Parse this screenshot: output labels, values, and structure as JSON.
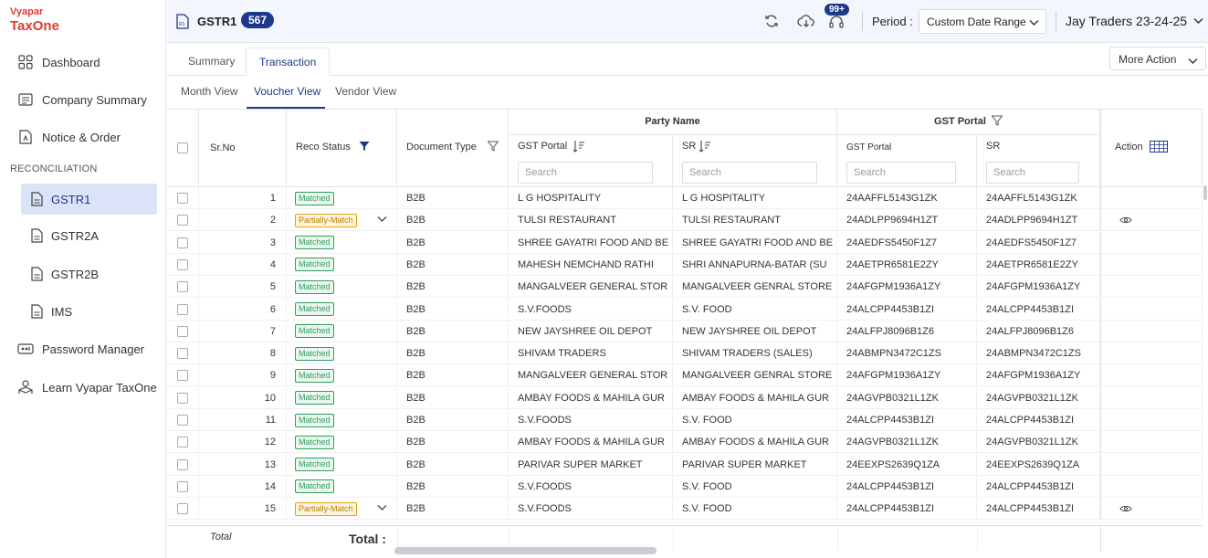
{
  "brand": {
    "line1": "Vyapar",
    "line2": "TaxOne"
  },
  "sidebar": {
    "items": [
      {
        "label": "Dashboard",
        "icon": "grid-icon"
      },
      {
        "label": "Company Summary",
        "icon": "list-icon"
      },
      {
        "label": "Notice & Order",
        "icon": "notice-icon"
      }
    ],
    "section": "RECONCILIATION",
    "sub_items": [
      {
        "label": "GSTR1",
        "icon": "document-icon",
        "active": true
      },
      {
        "label": "GSTR2A",
        "icon": "document-icon"
      },
      {
        "label": "GSTR2B",
        "icon": "document-icon"
      },
      {
        "label": "IMS",
        "icon": "document-icon"
      }
    ],
    "bottom_items": [
      {
        "label": "Password Manager",
        "icon": "key-icon"
      },
      {
        "label": "Learn Vyapar TaxOne",
        "icon": "learn-icon"
      }
    ]
  },
  "header": {
    "title": "GSTR1",
    "count": "567",
    "notifications": "99+",
    "period_label": "Period :",
    "period_value": "Custom Date Range",
    "company": "Jay Traders 23-24-25"
  },
  "tabs": [
    "Summary",
    "Transaction"
  ],
  "more_action": "More Action",
  "views": [
    "Month View",
    "Voucher View",
    "Vendor View"
  ],
  "table": {
    "headers": {
      "srno": "Sr.No",
      "reco": "Reco Status",
      "doctype": "Document Type",
      "party": "Party Name",
      "gst_group": "GST Portal",
      "portal": "GST Portal",
      "sr": "SR",
      "action": "Action"
    },
    "search_placeholder": "Search",
    "rows": [
      {
        "sr": "1",
        "status": "Matched",
        "doc": "B2B",
        "party_portal": "L G HOSPITALITY",
        "party_sr": "L G HOSPITALITY",
        "gst_portal": "24AAFFL5143G1ZK",
        "gst_sr": "24AAFFL5143G1ZK",
        "action": false
      },
      {
        "sr": "2",
        "status": "Partially-Match",
        "doc": "B2B",
        "party_portal": "TULSI RESTAURANT",
        "party_sr": "TULSI RESTAURANT",
        "gst_portal": "24ADLPP9694H1ZT",
        "gst_sr": "24ADLPP9694H1ZT",
        "action": true
      },
      {
        "sr": "3",
        "status": "Matched",
        "doc": "B2B",
        "party_portal": "SHREE GAYATRI FOOD AND BE",
        "party_sr": "SHREE GAYATRI FOOD AND BE",
        "gst_portal": "24AEDFS5450F1Z7",
        "gst_sr": "24AEDFS5450F1Z7",
        "action": false
      },
      {
        "sr": "4",
        "status": "Matched",
        "doc": "B2B",
        "party_portal": "MAHESH NEMCHAND RATHI",
        "party_sr": "SHRI ANNAPURNA-BATAR (SU",
        "gst_portal": "24AETPR6581E2ZY",
        "gst_sr": "24AETPR6581E2ZY",
        "action": false
      },
      {
        "sr": "5",
        "status": "Matched",
        "doc": "B2B",
        "party_portal": "MANGALVEER GENERAL STOR",
        "party_sr": "MANGALVEER GENRAL STORE",
        "gst_portal": "24AFGPM1936A1ZY",
        "gst_sr": "24AFGPM1936A1ZY",
        "action": false
      },
      {
        "sr": "6",
        "status": "Matched",
        "doc": "B2B",
        "party_portal": "S.V.FOODS",
        "party_sr": "S.V. FOOD",
        "gst_portal": "24ALCPP4453B1ZI",
        "gst_sr": "24ALCPP4453B1ZI",
        "action": false
      },
      {
        "sr": "7",
        "status": "Matched",
        "doc": "B2B",
        "party_portal": "NEW JAYSHREE OIL DEPOT",
        "party_sr": "NEW JAYSHREE OIL DEPOT",
        "gst_portal": "24ALFPJ8096B1Z6",
        "gst_sr": "24ALFPJ8096B1Z6",
        "action": false
      },
      {
        "sr": "8",
        "status": "Matched",
        "doc": "B2B",
        "party_portal": "SHIVAM TRADERS",
        "party_sr": "SHIVAM TRADERS (SALES)",
        "gst_portal": "24ABMPN3472C1ZS",
        "gst_sr": "24ABMPN3472C1ZS",
        "action": false
      },
      {
        "sr": "9",
        "status": "Matched",
        "doc": "B2B",
        "party_portal": "MANGALVEER GENERAL STOR",
        "party_sr": "MANGALVEER GENRAL STORE",
        "gst_portal": "24AFGPM1936A1ZY",
        "gst_sr": "24AFGPM1936A1ZY",
        "action": false
      },
      {
        "sr": "10",
        "status": "Matched",
        "doc": "B2B",
        "party_portal": "AMBAY FOODS & MAHILA GUR",
        "party_sr": "AMBAY FOODS & MAHILA GUR",
        "gst_portal": "24AGVPB0321L1ZK",
        "gst_sr": "24AGVPB0321L1ZK",
        "action": false
      },
      {
        "sr": "11",
        "status": "Matched",
        "doc": "B2B",
        "party_portal": "S.V.FOODS",
        "party_sr": "S.V. FOOD",
        "gst_portal": "24ALCPP4453B1ZI",
        "gst_sr": "24ALCPP4453B1ZI",
        "action": false
      },
      {
        "sr": "12",
        "status": "Matched",
        "doc": "B2B",
        "party_portal": "AMBAY FOODS & MAHILA GUR",
        "party_sr": "AMBAY FOODS & MAHILA GUR",
        "gst_portal": "24AGVPB0321L1ZK",
        "gst_sr": "24AGVPB0321L1ZK",
        "action": false
      },
      {
        "sr": "13",
        "status": "Matched",
        "doc": "B2B",
        "party_portal": "PARIVAR SUPER MARKET",
        "party_sr": "PARIVAR SUPER MARKET",
        "gst_portal": "24EEXPS2639Q1ZA",
        "gst_sr": "24EEXPS2639Q1ZA",
        "action": false
      },
      {
        "sr": "14",
        "status": "Matched",
        "doc": "B2B",
        "party_portal": "S.V.FOODS",
        "party_sr": "S.V. FOOD",
        "gst_portal": "24ALCPP4453B1ZI",
        "gst_sr": "24ALCPP4453B1ZI",
        "action": false
      },
      {
        "sr": "15",
        "status": "Partially-Match",
        "doc": "B2B",
        "party_portal": "S.V.FOODS",
        "party_sr": "S.V. FOOD",
        "gst_portal": "24ALCPP4453B1ZI",
        "gst_sr": "24ALCPP4453B1ZI",
        "action": true
      }
    ],
    "total_label": "Total",
    "total_value_label": "Total :"
  },
  "colors": {
    "accent": "#1d3a8a",
    "brand": "#e03a2e",
    "matched": "#2f9e5e",
    "partial": "#e4a317"
  }
}
